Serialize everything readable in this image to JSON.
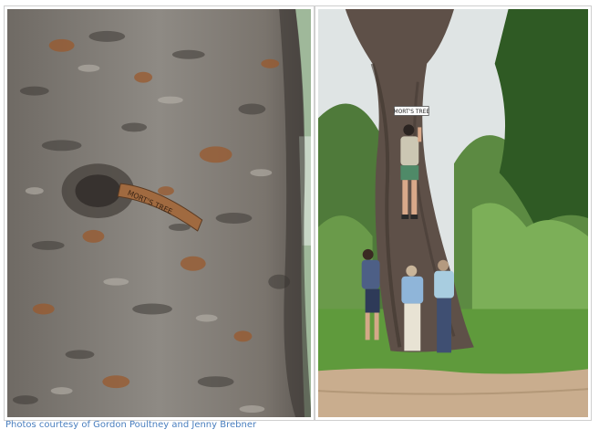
{
  "caption": "Photos courtesy of Gordon Poultney and Jenny Brebner",
  "left_photo": {
    "subject": "close-up of tree bark with embedded metal plate",
    "plate_text": "MORT'S TREE"
  },
  "right_photo": {
    "subject": "large tree with sign, person climbing and three people at base",
    "sign_text": "MORT'S TREE"
  }
}
